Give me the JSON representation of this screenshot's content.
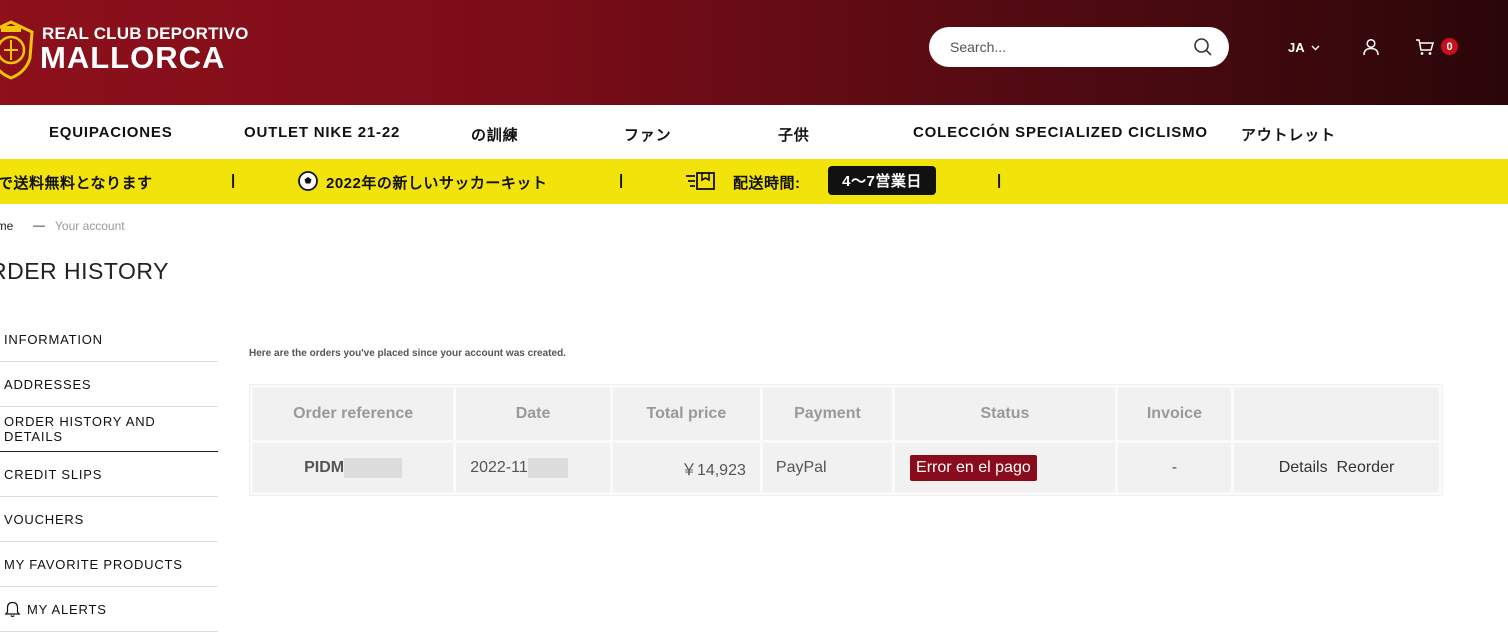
{
  "header": {
    "brand_line1": "REAL CLUB DEPORTIVO",
    "brand_line2": "MALLORCA",
    "search_placeholder": "Search...",
    "language": "JA",
    "cart_count": "0"
  },
  "nav": {
    "items": [
      "EQUIPACIONES",
      "OUTLET NIKE 21-22",
      "の訓練",
      "ファン",
      "子供",
      "COLECCIÓN SPECIALIZED CICLISMO",
      "アウトレット"
    ]
  },
  "promo": {
    "free_shipping": "で送料無料となります",
    "separator": "|",
    "kit": "2022年の新しいサッカーキット",
    "delivery_label": "配送時間:",
    "delivery_value": "4〜7営業日"
  },
  "breadcrumb": {
    "home": "ome",
    "separator": "—",
    "current": "Your account"
  },
  "page_title": "RDER HISTORY",
  "sidebar": {
    "items": [
      "INFORMATION",
      "ADDRESSES",
      "ORDER HISTORY AND DETAILS",
      "CREDIT SLIPS",
      "VOUCHERS",
      "MY FAVORITE PRODUCTS",
      "MY ALERTS"
    ]
  },
  "orders": {
    "intro": "Here are the orders you've placed since your account was created.",
    "columns": [
      "Order reference",
      "Date",
      "Total price",
      "Payment",
      "Status",
      "Invoice",
      ""
    ],
    "rows": [
      {
        "reference": "PIDM",
        "date": "2022-11",
        "total": "￥14,923",
        "payment": "PayPal",
        "status": "Error en el pago",
        "invoice": "-",
        "details": "Details",
        "reorder": "Reorder"
      }
    ]
  },
  "colors": {
    "header_red": "#8d101c",
    "promo_yellow": "#f2e40a",
    "status_error": "#8a0b1b",
    "badge_red": "#c8101e"
  }
}
